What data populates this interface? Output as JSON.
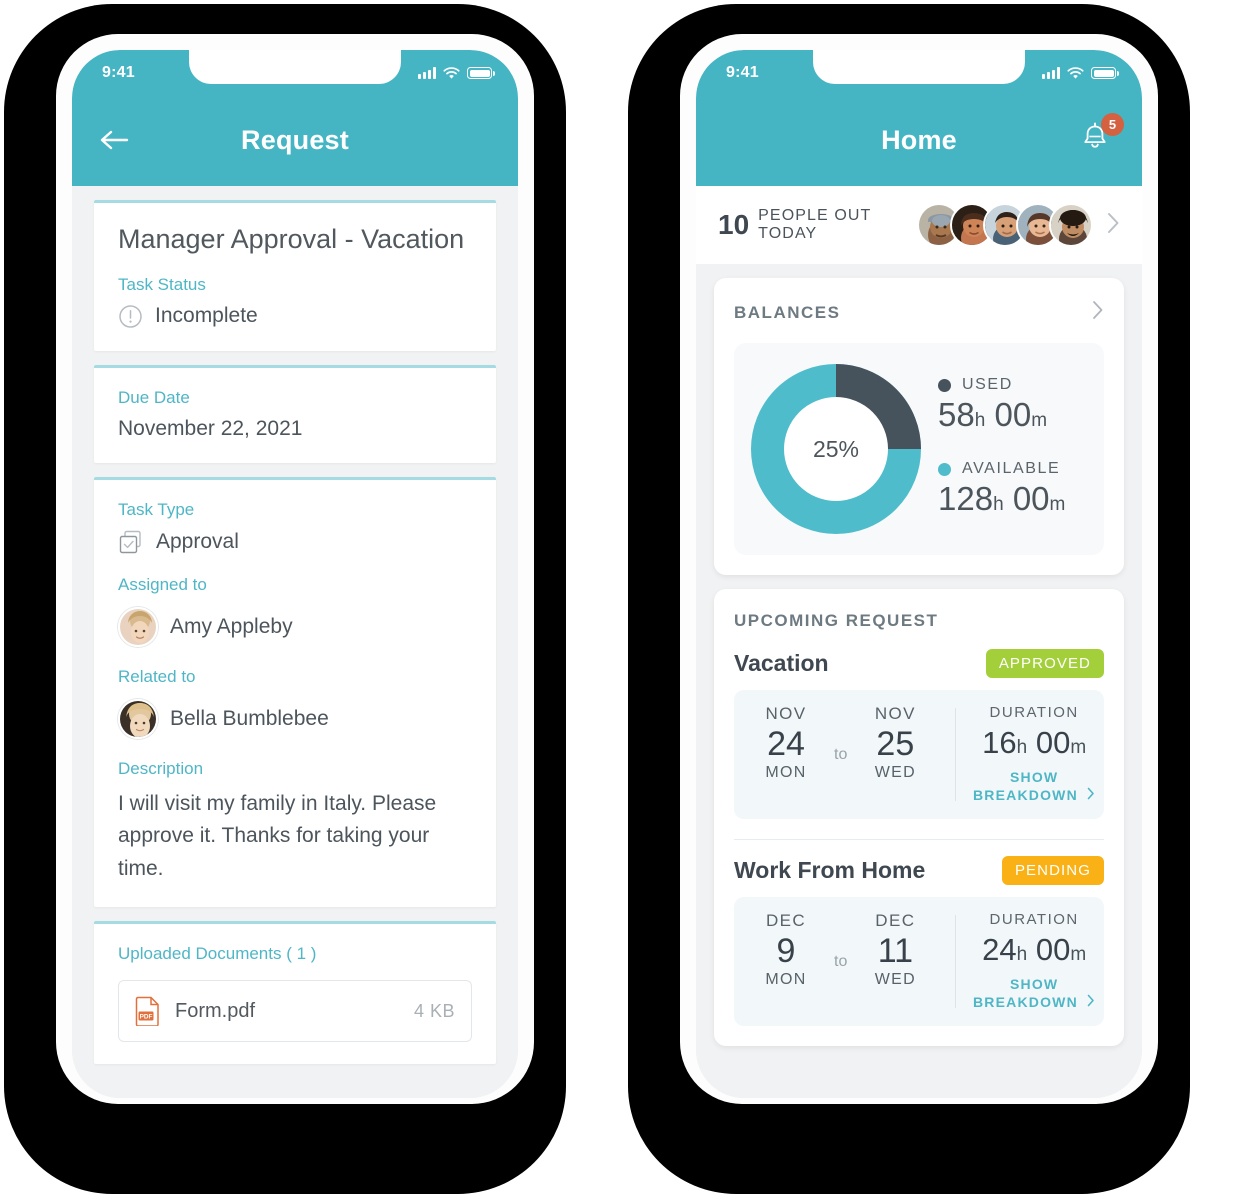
{
  "theme": {
    "teal": "#45b5c4",
    "teal_light": "#a5dbe3",
    "label_teal": "#4fb6c6",
    "text_dark": "#4d555c",
    "approved_green": "#a3d03a",
    "pending_orange": "#f9b116",
    "badge_red": "#d4613f",
    "pdf_orange": "#e2703a",
    "donut_used": "#46525c",
    "donut_available": "#4fbccb"
  },
  "left_phone": {
    "status_bar": {
      "clock": "9:41",
      "signal_icon": "signal-bars-icon",
      "wifi_icon": "wifi-icon",
      "battery_icon": "battery-icon"
    },
    "navbar": {
      "back_icon": "back-arrow-icon",
      "title": "Request"
    },
    "task": {
      "heading": "Manager Approval - Vacation",
      "status_label": "Task Status",
      "status_icon": "exclamation-circle-icon",
      "status_value": "Incomplete",
      "due_label": "Due Date",
      "due_value": "November 22, 2021",
      "type_label": "Task Type",
      "type_icon": "checkbox-stack-icon",
      "type_value": "Approval",
      "assigned_label": "Assigned to",
      "assigned_value": "Amy Appleby",
      "related_label": "Related to",
      "related_value": "Bella Bumblebee",
      "description_label": "Description",
      "description_value": "I will visit my family in Italy. Please approve it. Thanks for taking your time.",
      "documents_label": "Uploaded Documents ( 1 )",
      "documents": [
        {
          "icon": "pdf-file-icon",
          "name": "Form.pdf",
          "size": "4 KB"
        }
      ]
    }
  },
  "right_phone": {
    "status_bar": {
      "clock": "9:41",
      "signal_icon": "signal-bars-icon",
      "wifi_icon": "wifi-icon",
      "battery_icon": "battery-icon"
    },
    "navbar": {
      "title": "Home",
      "bell_icon": "notification-bell-icon",
      "badge_count": "5"
    },
    "people_out": {
      "count": "10",
      "label": "PEOPLE OUT TODAY",
      "chevron_icon": "chevron-right-icon",
      "avatar_count": 5
    },
    "balances": {
      "title": "BALANCES",
      "chevron_icon": "chevron-right-icon",
      "center_label": "25%",
      "legend": [
        {
          "label": "USED",
          "value": "58",
          "unit_h": "h",
          "minutes": "00",
          "unit_m": "m",
          "color": "#46525c"
        },
        {
          "label": "AVAILABLE",
          "value": "128",
          "unit_h": "h",
          "minutes": "00",
          "unit_m": "m",
          "color": "#4fbccb"
        }
      ]
    },
    "upcoming": {
      "title": "UPCOMING REQUEST",
      "requests": [
        {
          "name": "Vacation",
          "status": "APPROVED",
          "status_color": "#a3d03a",
          "start_month": "NOV",
          "start_day": "24",
          "start_dow": "MON",
          "to": "to",
          "end_month": "NOV",
          "end_day": "25",
          "end_dow": "WED",
          "duration_label": "DURATION",
          "duration_hours": "16",
          "unit_h": "h",
          "duration_minutes": "00",
          "unit_m": "m",
          "breakdown": "SHOW BREAKDOWN",
          "breakdown_icon": "chevron-right-icon"
        },
        {
          "name": "Work From Home",
          "status": "PENDING",
          "status_color": "#f9b116",
          "start_month": "DEC",
          "start_day": "9",
          "start_dow": "MON",
          "to": "to",
          "end_month": "DEC",
          "end_day": "11",
          "end_dow": "WED",
          "duration_label": "DURATION",
          "duration_hours": "24",
          "unit_h": "h",
          "duration_minutes": "00",
          "unit_m": "m",
          "breakdown": "SHOW BREAKDOWN",
          "breakdown_icon": "chevron-right-icon"
        }
      ]
    }
  },
  "chart_data": {
    "type": "pie",
    "title": "BALANCES",
    "categories": [
      "USED",
      "AVAILABLE"
    ],
    "values": [
      58,
      128
    ],
    "percentages": [
      25,
      75
    ],
    "center_label": "25%",
    "colors": [
      "#46525c",
      "#4fbccb"
    ],
    "units": "hours",
    "legend_position": "right",
    "donut": true
  }
}
